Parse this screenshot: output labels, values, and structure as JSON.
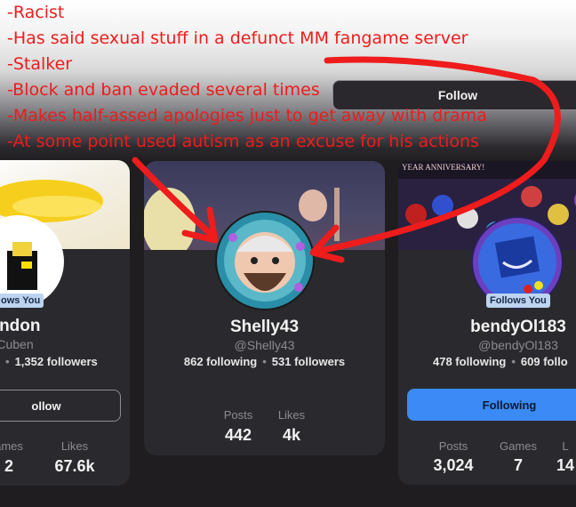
{
  "annotations": [
    "-Racist",
    "-Has said sexual stuff in a defunct MM fangame server",
    "-Stalker",
    "-Block and ban evaded several times",
    "-Makes half-assed apologies just to get away with drama",
    "-At some point used autism as an excuse for his actions"
  ],
  "top_follow_label": "Follow",
  "cards": [
    {
      "username": "andon",
      "handle": "Cuben",
      "badge": "ows You",
      "following_partial": "•",
      "followers": "1,352 followers",
      "button": "ollow",
      "stat1_label": "ames",
      "stat1_value": "2",
      "stat2_label": "Likes",
      "stat2_value": "67.6k"
    },
    {
      "username": "Shelly43",
      "handle": "@Shelly43",
      "following": "862 following",
      "followers": "531 followers",
      "stat1_label": "Posts",
      "stat1_value": "442",
      "stat2_label": "Likes",
      "stat2_value": "4k"
    },
    {
      "username": "bendyOl183",
      "handle": "@bendyOl183",
      "badge": "Follows You",
      "banner_text": "YEAR ANNIVERSARY!",
      "following": "478 following",
      "followers": "609 follo",
      "button": "Following",
      "stat1_label": "Posts",
      "stat1_value": "3,024",
      "stat2_label": "Games",
      "stat2_value": "7",
      "stat3_label": "L",
      "stat3_value": "14"
    }
  ],
  "colors": {
    "annotation": "#ee1c1c",
    "following_button": "#3b8af5",
    "card": "#2a2a2e"
  }
}
